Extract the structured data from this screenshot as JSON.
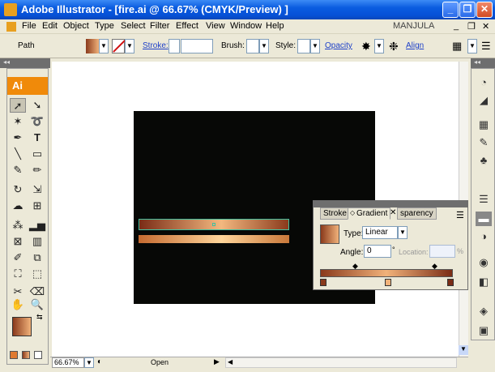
{
  "window": {
    "title": "Adobe Illustrator - [fire.ai @ 66.67% (CMYK/Preview) ]",
    "minimize": "_",
    "restore": "❐",
    "close": "✕",
    "inner_minimize": "_",
    "inner_restore": "❐",
    "inner_close": "✕"
  },
  "menu": {
    "items": [
      "File",
      "Edit",
      "Object",
      "Type",
      "Select",
      "Filter",
      "Effect",
      "View",
      "Window",
      "Help"
    ],
    "user": "MANJULA"
  },
  "control": {
    "selection": "Path",
    "stroke_label": "Stroke:",
    "brush_label": "Brush:",
    "style_label": "Style:",
    "opacity_label": "Opacity",
    "align_label": "Align"
  },
  "toolbox": {
    "logo": "Ai"
  },
  "status": {
    "zoom": "66.67%",
    "state": "Open"
  },
  "gradient_panel": {
    "tabs": [
      "Stroke",
      "Gradient",
      "sparency"
    ],
    "type_label": "Type:",
    "type_value": "Linear",
    "angle_label": "Angle:",
    "angle_value": "0",
    "angle_unit": "°",
    "location_label": "Location:",
    "location_unit": "%"
  },
  "colors": {
    "gradient_start": "#8a3a1c",
    "gradient_mid": "#f1b27a",
    "gradient_end": "#7a2c16",
    "artboard": "#070806",
    "titlebar": "#0a5ce0"
  }
}
